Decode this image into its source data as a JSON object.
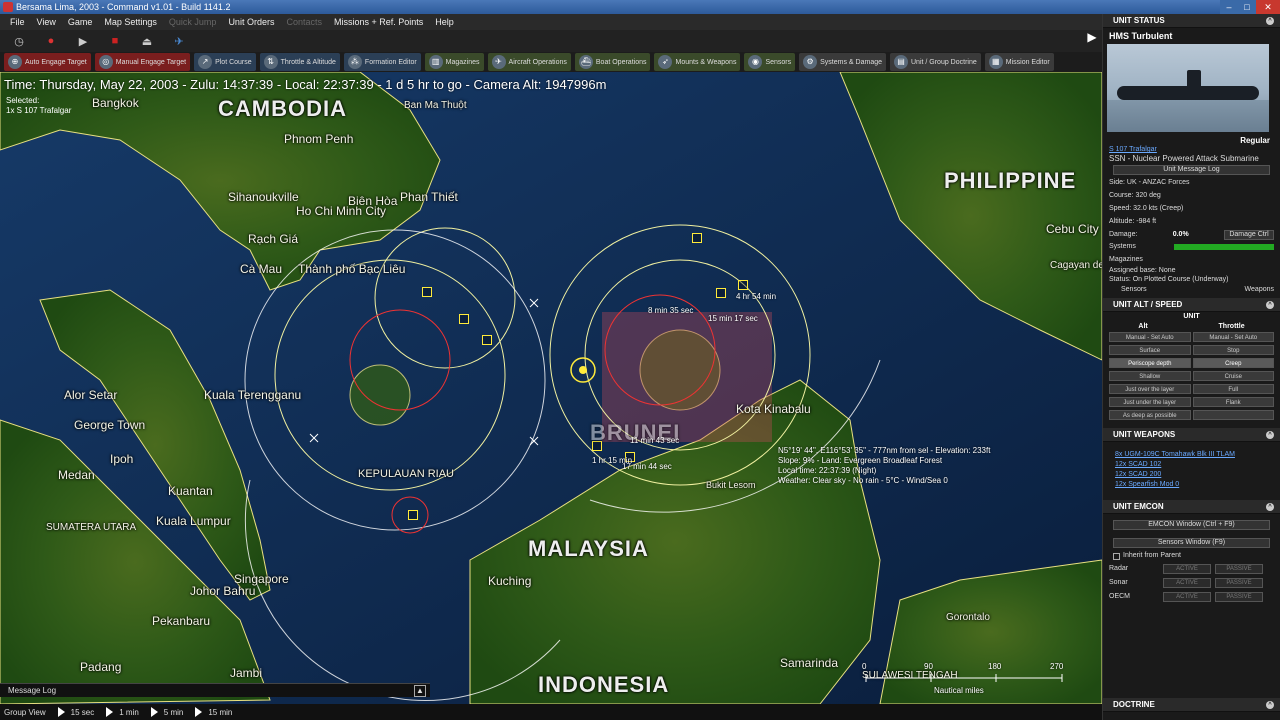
{
  "window": {
    "title": "Bersama Lima, 2003 - Command v1.01 - Build 1141.2"
  },
  "menu": [
    "File",
    "View",
    "Game",
    "Map Settings",
    "Quick Jump",
    "Unit Orders",
    "Contacts",
    "Missions + Ref. Points",
    "Help"
  ],
  "menu_disabled": [
    "Quick Jump",
    "Contacts"
  ],
  "toolbar2": [
    {
      "label": "Auto Engage Target",
      "style": "red",
      "icon": "crosshair-icon"
    },
    {
      "label": "Manual Engage Target",
      "style": "red",
      "icon": "target-icon"
    },
    {
      "label": "Plot Course",
      "style": "blue",
      "icon": "plot-course-icon"
    },
    {
      "label": "Throttle & Altitude",
      "style": "blue",
      "icon": "throttle-icon"
    },
    {
      "label": "Formation Editor",
      "style": "blue",
      "icon": "formation-icon"
    },
    {
      "label": "Magazines",
      "style": "olive",
      "icon": "magazines-icon"
    },
    {
      "label": "Aircraft Operations",
      "style": "olive",
      "icon": "aircraft-icon"
    },
    {
      "label": "Boat Operations",
      "style": "olive",
      "icon": "boat-icon"
    },
    {
      "label": "Mounts & Weapons",
      "style": "olive",
      "icon": "missile-icon"
    },
    {
      "label": "Sensors",
      "style": "olive",
      "icon": "radar-icon"
    },
    {
      "label": "Systems & Damage",
      "style": "gray",
      "icon": "gear-icon"
    },
    {
      "label": "Unit / Group Doctrine",
      "style": "gray",
      "icon": "doctrine-icon"
    },
    {
      "label": "Mission Editor",
      "style": "gray",
      "icon": "mission-icon"
    }
  ],
  "status": {
    "time": "Time: Thursday, May 22, 2003 - Zulu: 14:37:39 - Local: 22:37:39 - 1 d 5 hr to go - Camera Alt: 1947996m",
    "selected_label": "Selected:",
    "selected_unit": "1x S 107 Trafalgar"
  },
  "map": {
    "countries": [
      "CAMBODIA",
      "PHILIPPINE",
      "MALAYSIA",
      "INDONESIA",
      "BRUNEI"
    ],
    "regions": [
      "KEPULAUAN RIAU",
      "SULAWESI TENGAH",
      "SUMATERA UTARA"
    ],
    "cities": [
      "Bangkok",
      "Phnom Penh",
      "Sihanoukville",
      "Ho Chi Minh City",
      "Biên Hòa",
      "Phan Thiết",
      "Rạch Giá",
      "Cà Mau",
      "Thành phố Bạc Liêu",
      "Alor Setar",
      "George Town",
      "Ipoh",
      "Kuala Terengganu",
      "Medan",
      "Kuantan",
      "Kuala Lumpur",
      "Johor Bahru",
      "Singapore",
      "Pekanbaru",
      "Padang",
      "Jambi",
      "Kuching",
      "Kota Kinabalu",
      "Bukit Lesom",
      "Samarinda",
      "Cebu City",
      "Cagayan de Oro",
      "Ban Ma Thuột",
      "Gorontalo"
    ],
    "hud": [
      "8 min 35 sec",
      "4 hr 54 min",
      "15 min 17 sec",
      "11 min 43 sec",
      "17 min 44 sec",
      "1 hr 15 min"
    ],
    "cursor_info": [
      "N5°19' 44\", E116°53' 35\" - 777nm from sel - Elevation: 233ft",
      "Slope: 9% - Land: Evergreen Broadleaf Forest",
      "Local time: 22:37:39 (Night)",
      "Weather: Clear sky - No rain - 5°C - Wind/Sea 0"
    ],
    "scale": {
      "ticks": [
        "0",
        "90",
        "180",
        "270"
      ],
      "unit": "Nautical miles"
    }
  },
  "message_log": "Message Log",
  "time_compression": {
    "label": "Group View",
    "steps": [
      "15 sec",
      "1 min",
      "5 min",
      "15 min"
    ]
  },
  "panel": {
    "unit_status": {
      "header": "UNIT STATUS",
      "name": "HMS Turbulent",
      "proficiency": "Regular",
      "class_link": "S 107 Trafalgar",
      "type": "SSN - Nuclear Powered Attack Submarine",
      "log_button": "Unit Message Log",
      "side": "Side: UK - ANZAC Forces",
      "course": "Course: 320 deg",
      "speed": "Speed: 32.0 kts (Creep)",
      "altitude": "Altitude: -984 ft",
      "damage_label": "Damage:",
      "damage_value": "0.0%",
      "damage_button": "Damage Ctrl",
      "systems_label": "Systems",
      "systems_level": 1.0,
      "magazines": "Magazines",
      "base": "Assigned base: None",
      "status": "Status: On Plotted Course (Underway)",
      "sensors_btn": "Sensors",
      "weapons_btn": "Weapons"
    },
    "alt_speed": {
      "header": "UNIT ALT / SPEED",
      "tab": "UNIT",
      "col_alt": "Alt",
      "col_throttle": "Throttle",
      "alt_opts": [
        "Manual - Set Auto",
        "Surface",
        "Periscope depth",
        "Shallow",
        "Just over the layer",
        "Just under the layer",
        "As deep as possible"
      ],
      "thr_opts": [
        "Manual - Set Auto",
        "Stop",
        "Creep",
        "Cruise",
        "Full",
        "Flank"
      ],
      "alt_selected": "Periscope depth",
      "thr_selected": "Creep"
    },
    "weapons": {
      "header": "UNIT WEAPONS",
      "items": [
        "8x UGM-109C Tomahawk Blk III TLAM",
        "12x SCAD 102",
        "12x SCAD 200",
        "12x Spearfish Mod 0"
      ]
    },
    "emcon": {
      "header": "UNIT EMCON",
      "emcon_btn": "EMCON Window (Ctrl + F9)",
      "sensors_btn": "Sensors Window (F9)",
      "inherit": "Inherit from Parent",
      "rows": [
        {
          "label": "Radar"
        },
        {
          "label": "Sonar"
        },
        {
          "label": "OECM"
        }
      ],
      "active": "ACTIVE",
      "passive": "PASSIVE"
    },
    "doctrine": {
      "header": "DOCTRINE"
    }
  }
}
